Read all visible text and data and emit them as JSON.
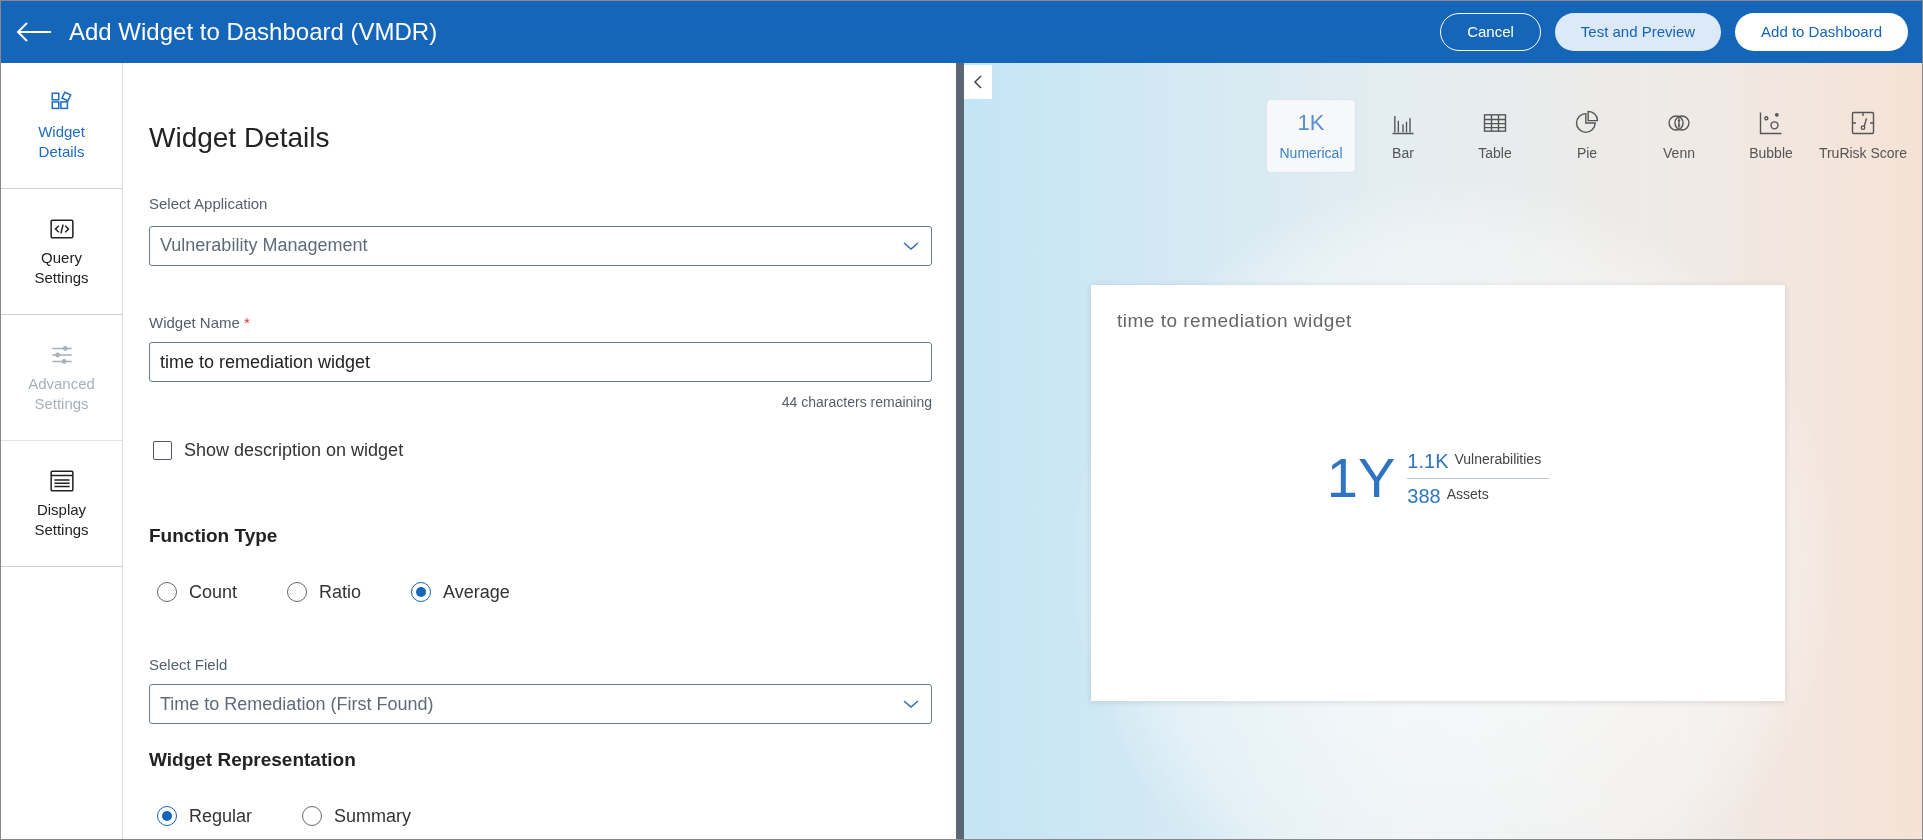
{
  "header": {
    "title": "Add Widget to Dashboard (VMDR)",
    "buttons": [
      {
        "label": "Cancel",
        "kind": "outline"
      },
      {
        "label": "Test and Preview",
        "kind": "soft"
      },
      {
        "label": "Add to Dashboard",
        "kind": "solid"
      }
    ]
  },
  "sidebar": {
    "items": [
      {
        "label": "Widget Details",
        "kind": "widgets",
        "selected": true,
        "disabled": false
      },
      {
        "label": "Query Settings",
        "kind": "code",
        "selected": false,
        "disabled": false
      },
      {
        "label": "Advanced Settings",
        "kind": "sliders",
        "selected": false,
        "disabled": true
      },
      {
        "label": "Display Settings",
        "kind": "display",
        "selected": false,
        "disabled": false
      }
    ]
  },
  "form": {
    "title": "Widget Details",
    "application": {
      "label": "Select Application",
      "value": "Vulnerability Management"
    },
    "widget_name": {
      "label": "Widget Name",
      "required_mark": "*",
      "value": "time to remediation widget",
      "hint": "44 characters remaining"
    },
    "show_description": {
      "label": "Show description on widget",
      "checked": false
    },
    "function_type": {
      "title": "Function Type",
      "options": [
        {
          "label": "Count",
          "selected": false
        },
        {
          "label": "Ratio",
          "selected": false
        },
        {
          "label": "Average",
          "selected": true
        }
      ]
    },
    "field": {
      "label": "Select Field",
      "value": "Time to Remediation (First Found)"
    },
    "representation": {
      "title": "Widget Representation",
      "options": [
        {
          "label": "Regular",
          "selected": true
        },
        {
          "label": "Summary",
          "selected": false
        }
      ]
    }
  },
  "preview": {
    "chart_types": [
      {
        "label": "Numerical",
        "kind": "numerical",
        "glyph": "1K",
        "selected": true
      },
      {
        "label": "Bar",
        "kind": "bar",
        "selected": false
      },
      {
        "label": "Table",
        "kind": "table",
        "selected": false
      },
      {
        "label": "Pie",
        "kind": "pie",
        "selected": false
      },
      {
        "label": "Venn",
        "kind": "venn",
        "selected": false
      },
      {
        "label": "Bubble",
        "kind": "bubble",
        "selected": false
      },
      {
        "label": "TruRisk Score",
        "kind": "score",
        "selected": false
      }
    ],
    "widget": {
      "title": "time to remediation widget",
      "value": "1Y",
      "stats": [
        {
          "value": "1.1K",
          "label": "Vulnerabilities"
        },
        {
          "value": "388",
          "label": "Assets"
        }
      ]
    }
  }
}
